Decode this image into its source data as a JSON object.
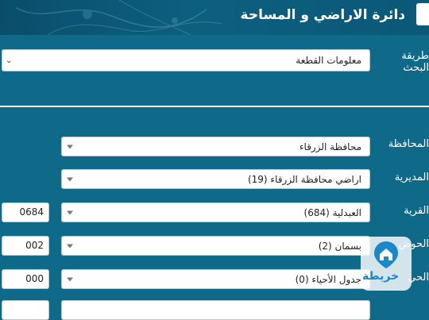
{
  "header": {
    "title": "دائرة الاراضي و المساحة"
  },
  "search": {
    "label": "طريقة البحث",
    "method": "معلومات القطعة"
  },
  "form": {
    "governorate": {
      "label": "المحافظة",
      "value": "محافظة الزرقاء"
    },
    "directorate": {
      "label": "المديرية",
      "value": "اراضي محافظة الزرقاء (19)"
    },
    "village": {
      "label": "القرية",
      "value": "العبدلية (684)",
      "code": "0684"
    },
    "basin": {
      "label": "الحوض",
      "value": "بسمان (2)",
      "code": "002"
    },
    "neighborhood": {
      "label": "الحي",
      "value": "جدول الأحياء (0)",
      "code": "000"
    }
  },
  "watermark": {
    "text": "خريطة",
    "icon": "home-map-pin-icon"
  },
  "colors": {
    "background": "#0f6a8a",
    "header": "#0b5878",
    "field": "#ffffff",
    "accent": "#1a88c9"
  }
}
